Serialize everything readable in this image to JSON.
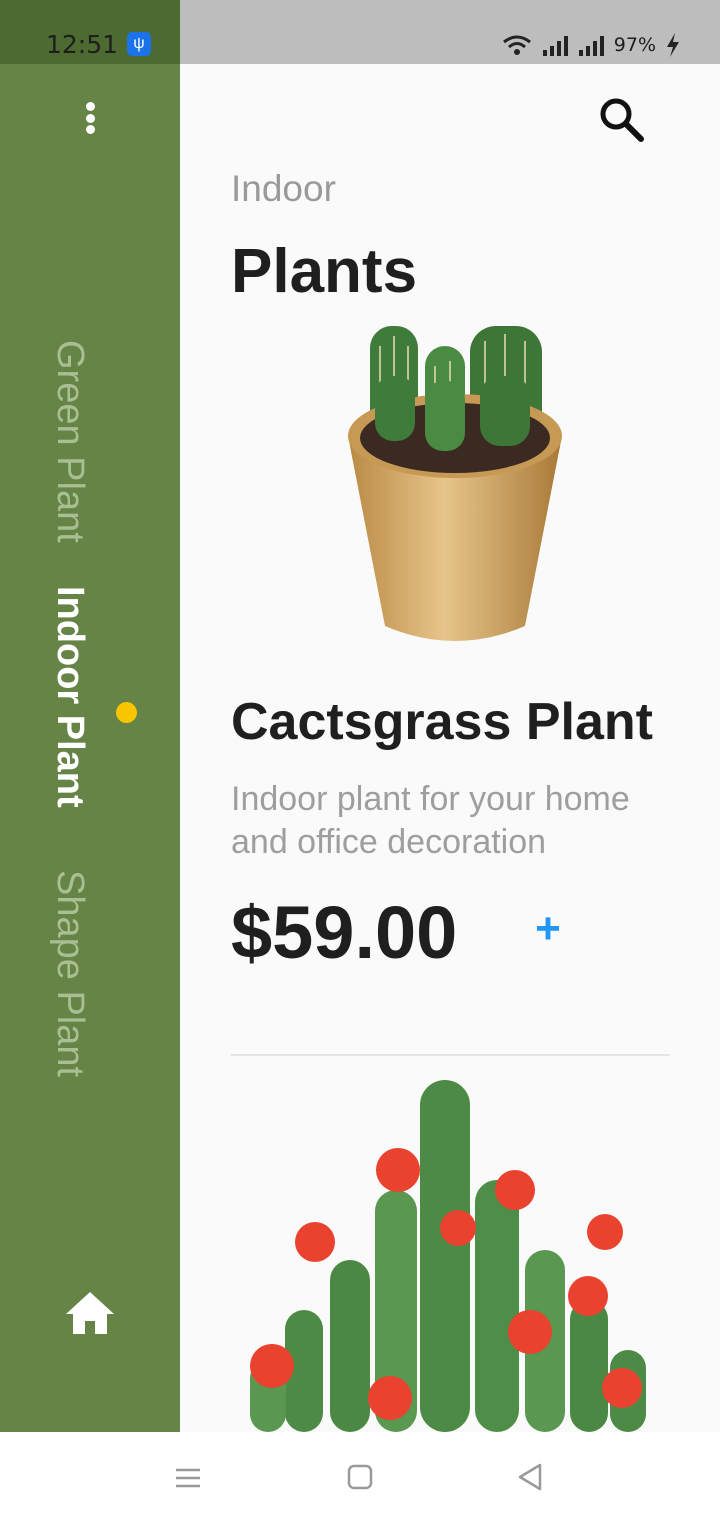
{
  "status_bar": {
    "time": "12:51",
    "battery": "97%",
    "icons": [
      "usb-icon",
      "wifi-icon",
      "signal-icon",
      "signal-icon",
      "charging-icon"
    ]
  },
  "sidebar": {
    "categories": [
      {
        "label": "Green Plant",
        "active": false
      },
      {
        "label": "Indoor Plant",
        "active": true
      },
      {
        "label": "Shape Plant",
        "active": false
      }
    ],
    "icons": [
      "more-vertical-icon",
      "home-icon"
    ]
  },
  "header": {
    "subtitle": "Indoor",
    "title": "Plants"
  },
  "product": {
    "name": "Cactsgrass Plant",
    "description": "Indoor plant for your home and office decoration",
    "price": "$59.00",
    "add_label": "+"
  },
  "navbar": {
    "icons": [
      "menu-icon",
      "home-square-icon",
      "back-triangle-icon"
    ]
  },
  "colors": {
    "sidebar": "#668445",
    "sidebar_status": "#4d6a30",
    "active_dot": "#f7c600",
    "accent": "#2196f3",
    "text_dark": "#1f1f1f",
    "text_muted": "#9e9e9e"
  }
}
